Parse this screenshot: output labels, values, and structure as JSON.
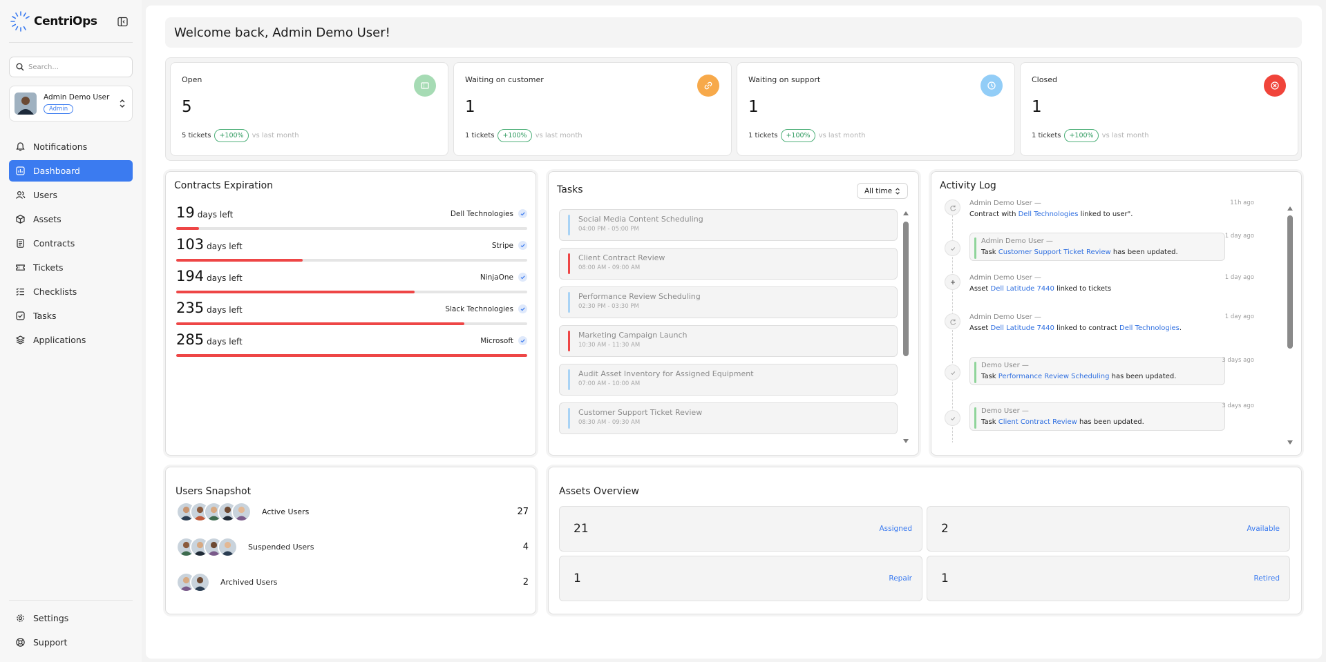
{
  "app": {
    "name": "CentriOps"
  },
  "sidebar": {
    "search_placeholder": "Search...",
    "user": {
      "name": "Admin Demo User",
      "role": "Admin"
    },
    "nav": [
      {
        "label": "Notifications",
        "icon": "bell-icon"
      },
      {
        "label": "Dashboard",
        "icon": "dashboard-icon",
        "active": true
      },
      {
        "label": "Users",
        "icon": "users-icon"
      },
      {
        "label": "Assets",
        "icon": "box-icon"
      },
      {
        "label": "Contracts",
        "icon": "document-icon"
      },
      {
        "label": "Tickets",
        "icon": "ticket-icon"
      },
      {
        "label": "Checklists",
        "icon": "checklist-icon"
      },
      {
        "label": "Tasks",
        "icon": "check-square-icon"
      },
      {
        "label": "Applications",
        "icon": "layers-icon"
      }
    ],
    "bottom_nav": [
      {
        "label": "Settings",
        "icon": "gear-icon"
      },
      {
        "label": "Support",
        "icon": "lifebuoy-icon"
      }
    ]
  },
  "welcome": "Welcome back, Admin Demo User!",
  "stats": [
    {
      "label": "Open",
      "value": "5",
      "tickets": "5 tickets",
      "change": "+100%",
      "compare": "vs last month",
      "color": "#a6dbb4"
    },
    {
      "label": "Waiting on customer",
      "value": "1",
      "tickets": "1 tickets",
      "change": "+100%",
      "compare": "vs last month",
      "color": "#f7a94a"
    },
    {
      "label": "Waiting on support",
      "value": "1",
      "tickets": "1 tickets",
      "change": "+100%",
      "compare": "vs last month",
      "color": "#92cdf7"
    },
    {
      "label": "Closed",
      "value": "1",
      "tickets": "1 tickets",
      "change": "+100%",
      "compare": "vs last month",
      "color": "#f0443a"
    }
  ],
  "contracts": {
    "title": "Contracts Expiration",
    "days_suffix": "days left",
    "items": [
      {
        "days": "19",
        "vendor": "Dell Technologies",
        "progress": 0.065
      },
      {
        "days": "103",
        "vendor": "Stripe",
        "progress": 0.36
      },
      {
        "days": "194",
        "vendor": "NinjaOne",
        "progress": 0.68
      },
      {
        "days": "235",
        "vendor": "Slack Technologies",
        "progress": 0.82
      },
      {
        "days": "285",
        "vendor": "Microsoft",
        "progress": 1.0
      }
    ]
  },
  "tasks": {
    "title": "Tasks",
    "filter": "All time",
    "items": [
      {
        "title": "Social Media Content Scheduling",
        "time": "04:00 PM - 05:00 PM",
        "color": "#a9d3f5"
      },
      {
        "title": "Client Contract Review",
        "time": "08:00 AM - 09:00 AM",
        "color": "#ee4646"
      },
      {
        "title": "Performance Review Scheduling",
        "time": "02:30 PM - 03:30 PM",
        "color": "#a9d3f5"
      },
      {
        "title": "Marketing Campaign Launch",
        "time": "10:30 AM - 11:30 AM",
        "color": "#ee4646"
      },
      {
        "title": "Audit Asset Inventory for Assigned Equipment",
        "time": "07:00 AM - 10:00 AM",
        "color": "#a9d3f5"
      },
      {
        "title": "Customer Support Ticket Review",
        "time": "08:30 AM - 09:30 AM",
        "color": "#a9d3f5"
      }
    ]
  },
  "activity": {
    "title": "Activity Log",
    "items": [
      {
        "who": "Admin Demo User —",
        "pre": "Contract with ",
        "link": "Dell Technologies",
        "post": " linked to user\".",
        "time": "11h ago",
        "icon": "refresh-icon",
        "boxed": false
      },
      {
        "who": "Admin Demo User —",
        "pre": "Task ",
        "link": "Customer Support Ticket Review",
        "post": " has been updated.",
        "time": "1 day ago",
        "icon": "check-icon",
        "boxed": true
      },
      {
        "who": "Admin Demo User —",
        "pre": "Asset ",
        "link": "Dell Latitude 7440",
        "post": " linked to tickets",
        "time": "1 day ago",
        "icon": "plus-icon",
        "boxed": false
      },
      {
        "who": "Admin Demo User —",
        "pre": "Asset ",
        "link": "Dell Latitude 7440",
        "post": " linked to contract ",
        "link2": "Dell Technologies",
        "post2": ".",
        "time": "1 day ago",
        "icon": "refresh-icon",
        "boxed": false
      },
      {
        "who": "Demo User —",
        "pre": "Task ",
        "link": "Performance Review Scheduling",
        "post": " has been updated.",
        "time": "3 days ago",
        "icon": "check-icon",
        "boxed": true
      },
      {
        "who": "Demo User —",
        "pre": "Task ",
        "link": "Client Contract Review",
        "post": " has been updated.",
        "time": "3 days ago",
        "icon": "check-icon",
        "boxed": true
      }
    ]
  },
  "users_snapshot": {
    "title": "Users Snapshot",
    "rows": [
      {
        "label": "Active Users",
        "count": "27",
        "avatars": 5
      },
      {
        "label": "Suspended Users",
        "count": "4",
        "avatars": 4
      },
      {
        "label": "Archived Users",
        "count": "2",
        "avatars": 2
      }
    ]
  },
  "assets": {
    "title": "Assets Overview",
    "items": [
      {
        "value": "21",
        "label": "Assigned"
      },
      {
        "value": "2",
        "label": "Available"
      },
      {
        "value": "1",
        "label": "Repair"
      },
      {
        "value": "1",
        "label": "Retired"
      }
    ]
  }
}
